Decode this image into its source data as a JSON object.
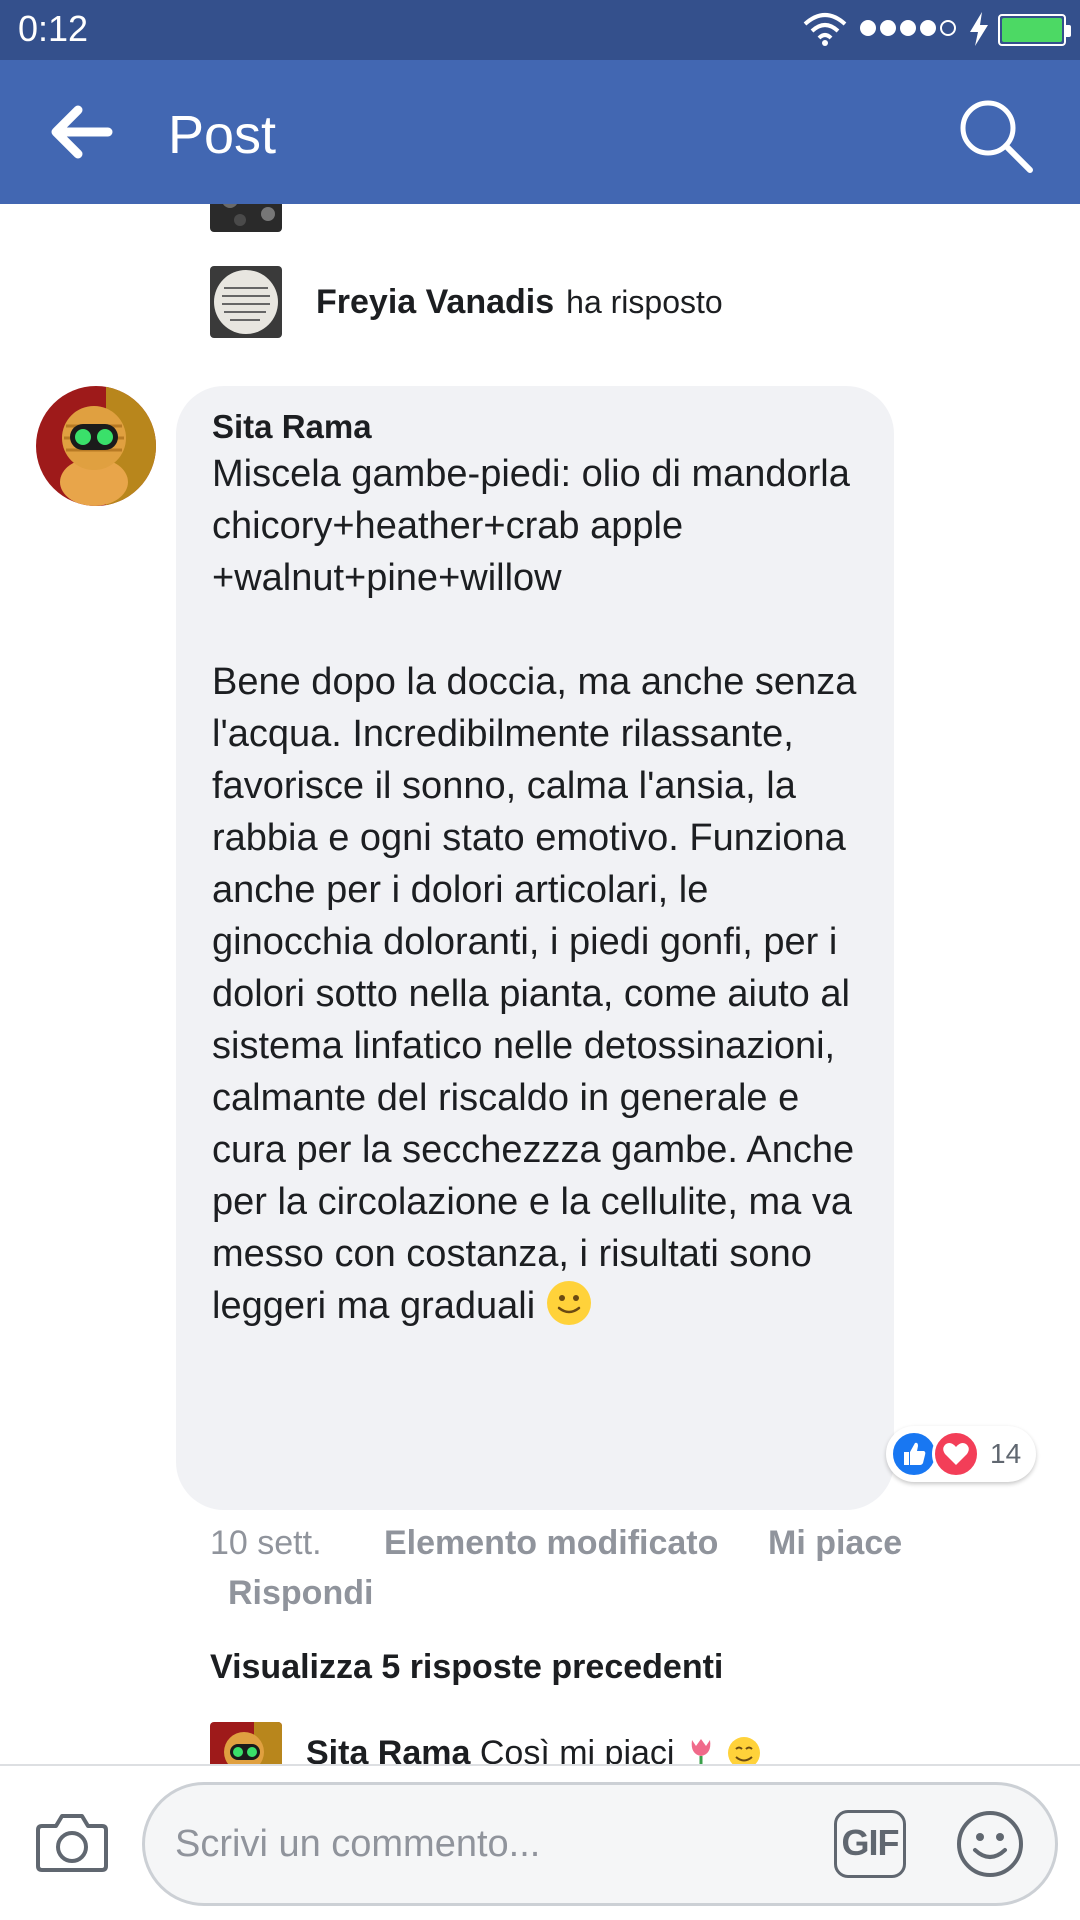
{
  "status_bar": {
    "time": "0:12",
    "icons": [
      "wifi-icon",
      "signal-icon",
      "charging-icon",
      "battery-icon"
    ]
  },
  "app_bar": {
    "title": "Post",
    "icons": [
      "back-arrow-icon",
      "search-icon"
    ],
    "color": "#4267b2"
  },
  "replies_top": [
    {
      "name": "Freyia Vanadis",
      "action": "ha risposto"
    }
  ],
  "comment": {
    "author": "Sita Rama",
    "text": "Miscela gambe-piedi: olio di mandorla\nchicory+heather+crab apple +walnut+pine+willow\n\nBene dopo la doccia, ma anche senza l'acqua. Incredibilmente rilassante, favorisce il sonno, calma l'ansia, la rabbia e ogni stato emotivo. Funziona anche per i dolori articolari, le ginocchia doloranti, i piedi gonfi, per i dolori sotto nella pianta, come aiuto al sistema linfatico nelle detossinazioni, calmante del riscaldo in generale e cura per la secchezzza gambe. Anche per la circolazione e la cellulite, ma va messo con costanza, i risultati sono leggeri ma graduali",
    "emoji": "slightly-smiling-face",
    "reactions": {
      "types": [
        "like",
        "love"
      ],
      "count": "14"
    },
    "meta": {
      "time": "10 sett.",
      "edited": "Elemento modificato",
      "like": "Mi piace",
      "reply": "Rispondi"
    }
  },
  "more_replies": "Visualizza 5 risposte precedenti",
  "nested_reply": {
    "name": "Sita Rama",
    "text": "Così mi piaci",
    "emojis": [
      "tulip",
      "smiling-face"
    ]
  },
  "composer": {
    "placeholder": "Scrivi un commento...",
    "gif_label": "GIF",
    "icons": [
      "camera-icon",
      "gif-icon",
      "smiley-icon"
    ]
  }
}
